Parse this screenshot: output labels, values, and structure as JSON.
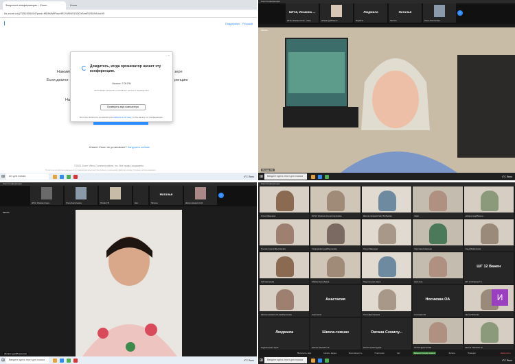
{
  "q1": {
    "tabs": [
      "Запустить конференцию :: Zoom",
      "Zoom"
    ],
    "address": "0s.zoom.us/j/72515054547pwd=MDhMWRwcHRJVWNiSGl3OXNmRlZ4MVhtzz09",
    "header_links": [
      "Поддержка",
      "Русский"
    ],
    "bg_lines": [
      "Нажмите",
      "зере",
      "Если диалог",
      "ренцию",
      "Наж"
    ],
    "dialog": {
      "title": "Дождитесь, когда организатор начнет эту конференцию.",
      "time": "Начало: 7:00 PM",
      "subtitle": "Безопасное решение о COVID-19: регион и переводчики",
      "button": "Проверить звук компьютера",
      "footer_pre": "Если вы являетесь организатором ",
      "footer_link": "войдите в систему",
      "footer_post": ", чтобы начать эту конференцию."
    },
    "not_installed": "Клиент Zoom не установлен?",
    "download": "Загрузить сейчас",
    "copyright": "©2021 Zoom Video Communications, Inc. Все права защищены.",
    "copyright2": "Политика конфиденциальности и законодательства  Политика в отношении файлов cookie  Условия использования"
  },
  "taskbars": {
    "search": "Введите здесь текст для поиска",
    "search_short": "ест для поиска",
    "temp": "4°C  Ясно"
  },
  "q2": {
    "title": "Zoom Конференция",
    "tiles": [
      {
        "name": "ШГ12, Исакина ...",
        "label": "ШГ12, Исакина Алена...  Амир"
      },
      {
        "name": "",
        "label": "айсара кудайберген..."
      },
      {
        "name": "Людмила",
        "label": "Людмила"
      },
      {
        "name": "Наталья",
        "label": "Наталья"
      },
      {
        "name": "",
        "label": "Ольга Анатольевна"
      }
    ],
    "rec": "Запись",
    "speaker": "Попова Г.В."
  },
  "q3": {
    "title": "Zoom Конференция",
    "tiles": [
      {
        "name": "",
        "label": "ШГ12, Исакина Алена..."
      },
      {
        "name": "",
        "label": "Ольга Анатольевна"
      },
      {
        "name": "",
        "label": "Попова Г.В."
      },
      {
        "name": "",
        "label": "Ами"
      },
      {
        "name": "Наталья",
        "label": "Наталья"
      },
      {
        "name": "",
        "label": "Школа гимназия №12"
      }
    ],
    "rec": "Запись",
    "speaker": "айсара кудайбергенова"
  },
  "q4": {
    "title": "Zoom Конференция",
    "cells": [
      {
        "name": "",
        "label": "Ольга Ивановна"
      },
      {
        "name": "",
        "label": "ШГ12, Исакина Алена Сергеевна"
      },
      {
        "name": "",
        "label": "Школа-гимназия №12 Рыбакова"
      },
      {
        "name": "",
        "label": "Амир"
      },
      {
        "name": "",
        "label": "айсара кудайберген..."
      },
      {
        "name": "",
        "label": "Попова Сергей Дмитриевич"
      },
      {
        "name": "",
        "label": "Свиридова Кудайбергенова"
      },
      {
        "name": "",
        "label": "Ольга Ивановна"
      },
      {
        "name": "",
        "label": "Светлана Ковалева"
      },
      {
        "name": "",
        "label": "Саня Мифтахова"
      },
      {
        "name": "",
        "label": "Гай Чертанова"
      },
      {
        "name": "",
        "label": "Майна Курсыбаева"
      },
      {
        "name": "",
        "label": "Подключение звука"
      },
      {
        "name": "",
        "label": "Кристина"
      },
      {
        "name": "ШГ 12 Важен",
        "label": "ШГ 12 Исакина Г.А."
      },
      {
        "name": "",
        "label": "Школа-гимназия 12 Амабергенова"
      },
      {
        "name": "Анастасия",
        "label": "Анастасия"
      },
      {
        "name": "",
        "label": "Ольга Дмитриевна"
      },
      {
        "name": "Носикова ОА",
        "label": "Носикова ОА"
      },
      {
        "name": "",
        "label": "Ирина Власова"
      },
      {
        "name": "Людмила",
        "label": "Подключение звука"
      },
      {
        "name": "Школа-гимназ",
        "label": "Школа гимназия 12"
      },
      {
        "name": "Оксана Семилу...",
        "label": "Оксана Семилудина"
      },
      {
        "name": "",
        "label": "Галина Догитасова"
      },
      {
        "name": "",
        "label": "Школа гимназия 12"
      }
    ],
    "avatar_letter": "И",
    "controls": [
      "Включить звук",
      "Начать видео",
      "Безопасность",
      "Участники",
      "Чат",
      "Демонстрация экрана",
      "Запись",
      "Реакции"
    ],
    "end": "Завершить"
  }
}
